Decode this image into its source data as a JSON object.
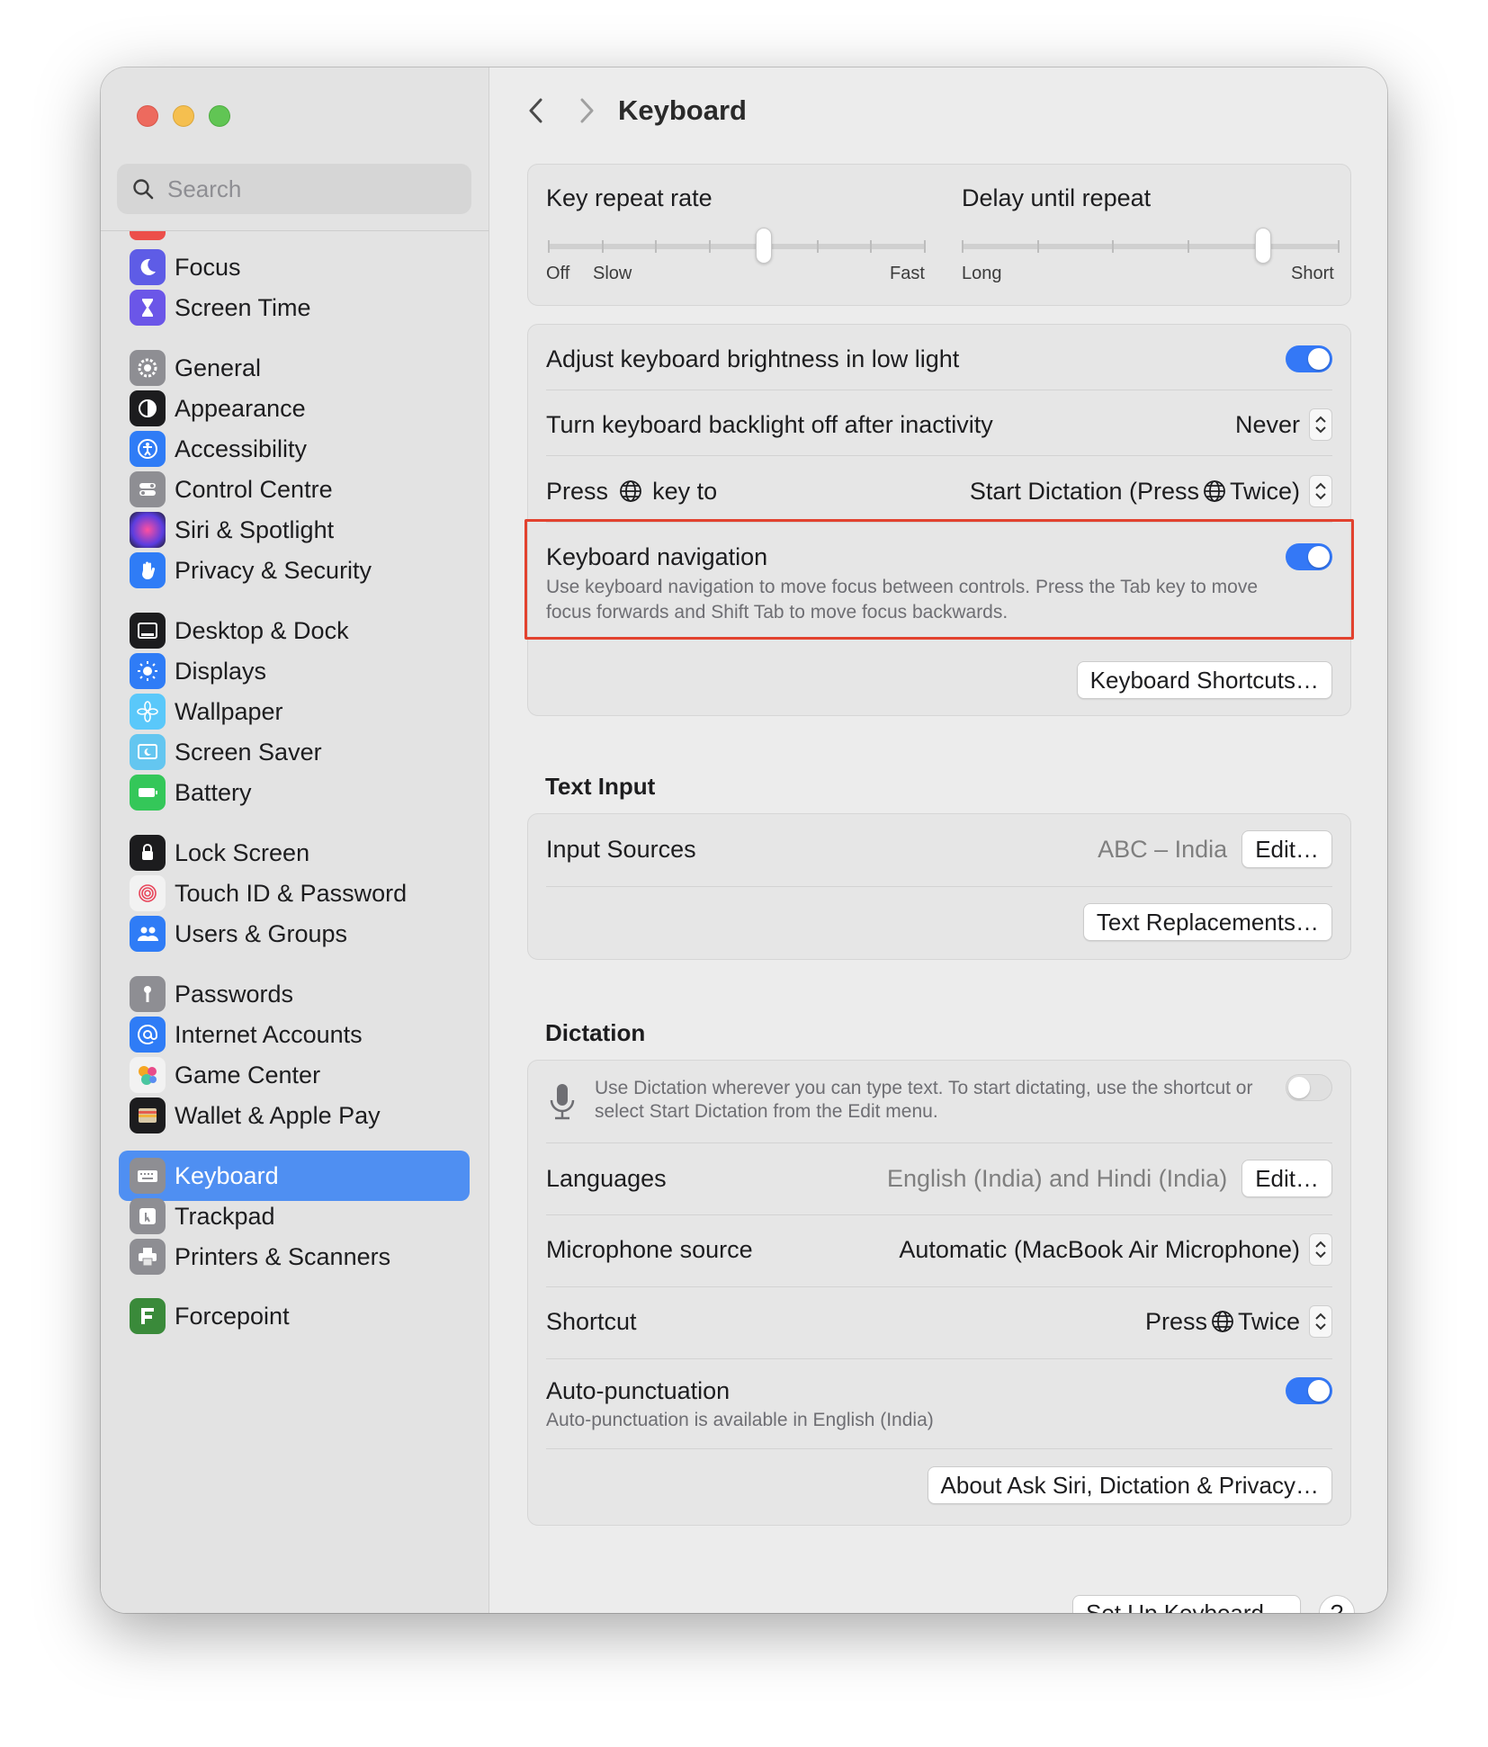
{
  "search": {
    "placeholder": "Search"
  },
  "sidebar": {
    "items": [
      {
        "label": "Focus",
        "icon": "moon-icon",
        "color": "#5e5ce6"
      },
      {
        "label": "Screen Time",
        "icon": "hourglass-icon",
        "color": "#6b56e8"
      },
      {
        "label": "General",
        "icon": "gear-icon",
        "color": "#8e8e93"
      },
      {
        "label": "Appearance",
        "icon": "appearance-icon",
        "color": "#1c1c1e"
      },
      {
        "label": "Accessibility",
        "icon": "accessibility-icon",
        "color": "#2f7cf6"
      },
      {
        "label": "Control Centre",
        "icon": "control-centre-icon",
        "color": "#8e8e93"
      },
      {
        "label": "Siri & Spotlight",
        "icon": "siri-icon",
        "color": "#7b3fd6"
      },
      {
        "label": "Privacy & Security",
        "icon": "hand-icon",
        "color": "#2f7cf6"
      },
      {
        "label": "Desktop & Dock",
        "icon": "dock-icon",
        "color": "#1c1c1e"
      },
      {
        "label": "Displays",
        "icon": "sun-icon",
        "color": "#2f7cf6"
      },
      {
        "label": "Wallpaper",
        "icon": "flower-icon",
        "color": "#5ac8fa"
      },
      {
        "label": "Screen Saver",
        "icon": "screen-saver-icon",
        "color": "#64c6f0"
      },
      {
        "label": "Battery",
        "icon": "battery-icon",
        "color": "#34c759"
      },
      {
        "label": "Lock Screen",
        "icon": "lock-icon",
        "color": "#1c1c1e"
      },
      {
        "label": "Touch ID & Password",
        "icon": "fingerprint-icon",
        "color": "#f2f2f2"
      },
      {
        "label": "Users & Groups",
        "icon": "users-icon",
        "color": "#2f7cf6"
      },
      {
        "label": "Passwords",
        "icon": "key-icon",
        "color": "#8e8e93"
      },
      {
        "label": "Internet Accounts",
        "icon": "at-icon",
        "color": "#2f7cf6"
      },
      {
        "label": "Game Center",
        "icon": "game-center-icon",
        "color": "#f2f2f2"
      },
      {
        "label": "Wallet & Apple Pay",
        "icon": "wallet-icon",
        "color": "#1c1c1e"
      },
      {
        "label": "Keyboard",
        "icon": "keyboard-icon",
        "color": "#8e8e93",
        "selected": true
      },
      {
        "label": "Trackpad",
        "icon": "trackpad-icon",
        "color": "#8e8e93"
      },
      {
        "label": "Printers & Scanners",
        "icon": "printer-icon",
        "color": "#8e8e93"
      },
      {
        "label": "Forcepoint",
        "icon": "forcepoint-icon",
        "color": "#3a8a3a"
      }
    ]
  },
  "header": {
    "title": "Keyboard"
  },
  "key_repeat": {
    "title": "Key repeat rate",
    "labels": [
      "Off",
      "Slow",
      "Fast"
    ],
    "value_tick": 4,
    "ticks": 8
  },
  "delay_repeat": {
    "title": "Delay until repeat",
    "labels": [
      "Long",
      "Short"
    ],
    "value_tick": 4,
    "ticks": 6
  },
  "backlight": {
    "adjust_label": "Adjust keyboard brightness in low light",
    "adjust_on": true,
    "off_label": "Turn keyboard backlight off after inactivity",
    "off_value": "Never",
    "press_label_pre": "Press",
    "press_label_post": "key to",
    "press_value_pre": "Start Dictation (Press",
    "press_value_post": "Twice)"
  },
  "keyboard_nav": {
    "label": "Keyboard navigation",
    "description": "Use keyboard navigation to move focus between controls. Press the Tab key to move focus forwards and Shift Tab to move focus backwards.",
    "on": true,
    "shortcuts_button": "Keyboard Shortcuts…"
  },
  "text_input": {
    "section": "Text Input",
    "sources_label": "Input Sources",
    "sources_value": "ABC – India",
    "edit_button": "Edit…",
    "replacements_button": "Text Replacements…"
  },
  "dictation": {
    "section": "Dictation",
    "description": "Use Dictation wherever you can type text. To start dictating, use the shortcut or select Start Dictation from the Edit menu.",
    "on": false,
    "languages_label": "Languages",
    "languages_value": "English (India) and Hindi (India)",
    "languages_edit": "Edit…",
    "mic_label": "Microphone source",
    "mic_value": "Automatic (MacBook Air Microphone)",
    "shortcut_label": "Shortcut",
    "shortcut_value_pre": "Press",
    "shortcut_value_post": "Twice",
    "autopunct_label": "Auto-punctuation",
    "autopunct_desc": "Auto-punctuation is available in English (India)",
    "autopunct_on": true,
    "about_button": "About Ask Siri, Dictation & Privacy…"
  },
  "footer": {
    "setup_button": "Set Up Keyboard…",
    "help": "?"
  },
  "colors": {
    "accent": "#3478f6",
    "selected_sidebar": "#4f8ff2",
    "highlight": "#e2422f"
  }
}
